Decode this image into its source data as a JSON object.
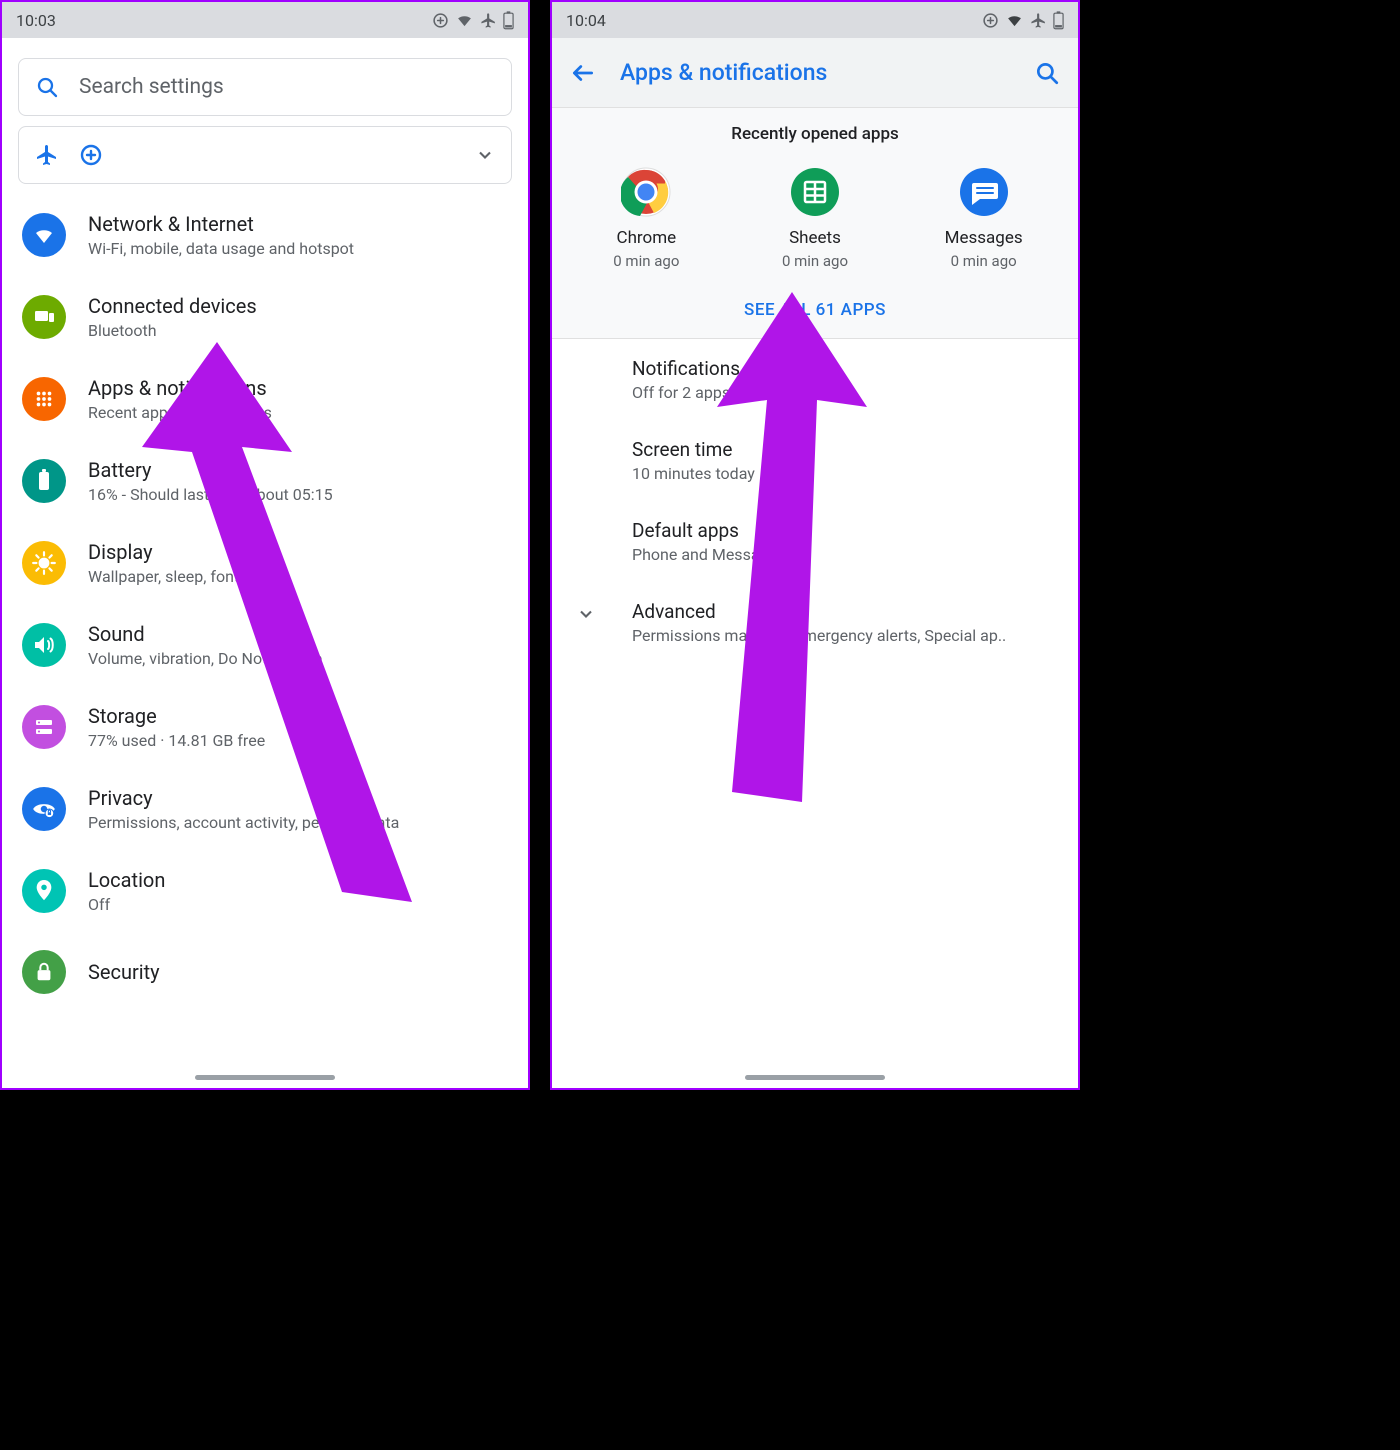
{
  "screen1": {
    "time": "10:03",
    "search_placeholder": "Search settings",
    "items": [
      {
        "title": "Network & Internet",
        "sub": "Wi-Fi, mobile, data usage and hotspot"
      },
      {
        "title": "Connected devices",
        "sub": "Bluetooth"
      },
      {
        "title": "Apps & notifications",
        "sub": "Recent apps, default apps"
      },
      {
        "title": "Battery",
        "sub": "16% - Should last until about 05:15"
      },
      {
        "title": "Display",
        "sub": "Wallpaper, sleep, font size"
      },
      {
        "title": "Sound",
        "sub": "Volume, vibration, Do Not Disturb"
      },
      {
        "title": "Storage",
        "sub": "77% used · 14.81 GB free"
      },
      {
        "title": "Privacy",
        "sub": "Permissions, account activity, personal data"
      },
      {
        "title": "Location",
        "sub": "Off"
      },
      {
        "title": "Security",
        "sub": ""
      }
    ]
  },
  "screen2": {
    "time": "10:04",
    "header_title": "Apps & notifications",
    "recent_title": "Recently opened apps",
    "recent_apps": [
      {
        "name": "Chrome",
        "time": "0 min ago"
      },
      {
        "name": "Sheets",
        "time": "0 min ago"
      },
      {
        "name": "Messages",
        "time": "0 min ago"
      }
    ],
    "see_all": "SEE ALL 61 APPS",
    "subs": [
      {
        "title": "Notifications",
        "sub": "Off for 2 apps"
      },
      {
        "title": "Screen time",
        "sub": "10 minutes today"
      },
      {
        "title": "Default apps",
        "sub": "Phone and Messages"
      },
      {
        "title": "Advanced",
        "sub": "Permissions manager, Emergency alerts, Special ap.."
      }
    ]
  }
}
